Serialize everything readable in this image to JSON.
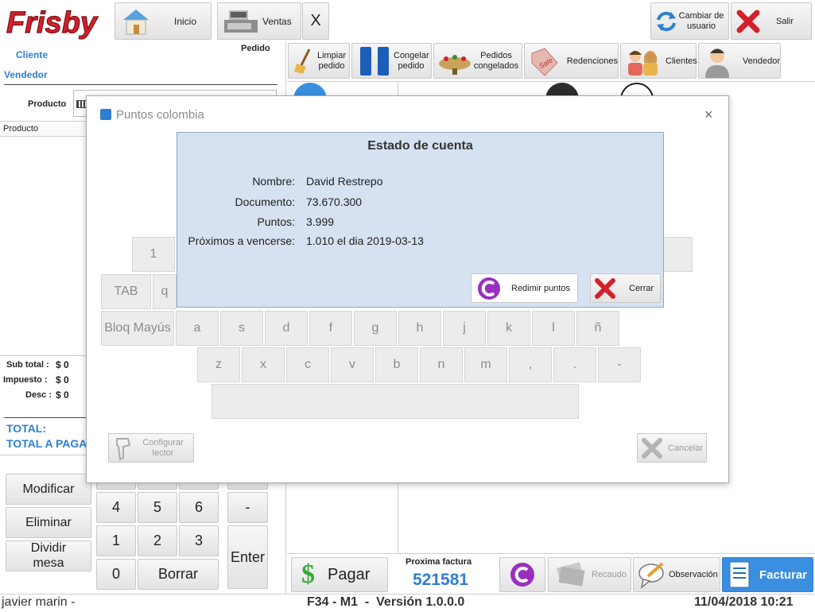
{
  "brand": {
    "logo": "Frisby"
  },
  "topbar": {
    "inicio": "Inicio",
    "ventas": "Ventas",
    "close_x": "X",
    "cambiar_usuario": "Cambiar de usuario",
    "salir": "Salir"
  },
  "left": {
    "cliente": "Cliente",
    "pedido": "Pedido",
    "vendedor": "Vendedor",
    "producto_label": "Producto",
    "table_header": "Producto",
    "subtotal_label": "Sub total :",
    "subtotal_value": "$ 0",
    "impuesto_label": "Impuesto :",
    "impuesto_value": "$ 0",
    "desc_label": "Desc :",
    "desc_value": "$ 0",
    "total_label": "TOTAL:",
    "total_pagar_label": "TOTAL A PAGAR"
  },
  "actions": {
    "modificar": "Modificar",
    "eliminar": "Eliminar",
    "dividir_mesa": "Dividir mesa"
  },
  "numpad": {
    "keys": [
      "4",
      "5",
      "6",
      "1",
      "2",
      "3",
      "0"
    ],
    "borrar": "Borrar",
    "minus": "-",
    "enter": "Enter"
  },
  "toolbar2": {
    "limpiar": "Limpiar pedido",
    "congelar": "Congelar pedido",
    "pedidos_congelados": "Pedidos congelados",
    "redenciones": "Redenciones",
    "clientes": "Clientes",
    "vendedor": "Vendedor"
  },
  "bottom": {
    "pagar": "Pagar",
    "proxima_label": "Proxima factura",
    "proxima_value": "521581",
    "recaudo": "Recaudo",
    "observacion": "Observación",
    "facturar": "Facturar"
  },
  "status": {
    "user": "javier marin -",
    "version": "F34 - M1  -  Versión 1.0.0.0",
    "datetime": "11/04/2018 10:21"
  },
  "dialog": {
    "title": "Puntos colombia",
    "close": "×",
    "configurar": "Configurar lector",
    "cancelar": "Cancelar",
    "kb_row1": [
      "1"
    ],
    "kb_tab": "TAB",
    "kb_q": "q",
    "kb_bloq": "Bloq Mayús",
    "kb_row3": [
      "a",
      "s",
      "d",
      "f",
      "g",
      "h",
      "j",
      "k",
      "l",
      "ñ"
    ],
    "kb_row4": [
      "z",
      "x",
      "c",
      "v",
      "b",
      "n",
      "m",
      ",",
      ".",
      "-"
    ]
  },
  "estado": {
    "title": "Estado de cuenta",
    "nombre_label": "Nombre:",
    "nombre_value": "David Restrepo",
    "documento_label": "Documento:",
    "documento_value": "73.670.300",
    "puntos_label": "Puntos:",
    "puntos_value": "3.999",
    "vencer_label": "Próximos a vencerse:",
    "vencer_value": "1.010 el dia 2019-03-13",
    "redimir": "Redimir puntos",
    "cerrar": "Cerrar"
  },
  "colors": {
    "accent": "#2f7fd0",
    "brand_red": "#d4202c",
    "panel": "#d6e2f1",
    "facturar": "#3a8fe0"
  }
}
